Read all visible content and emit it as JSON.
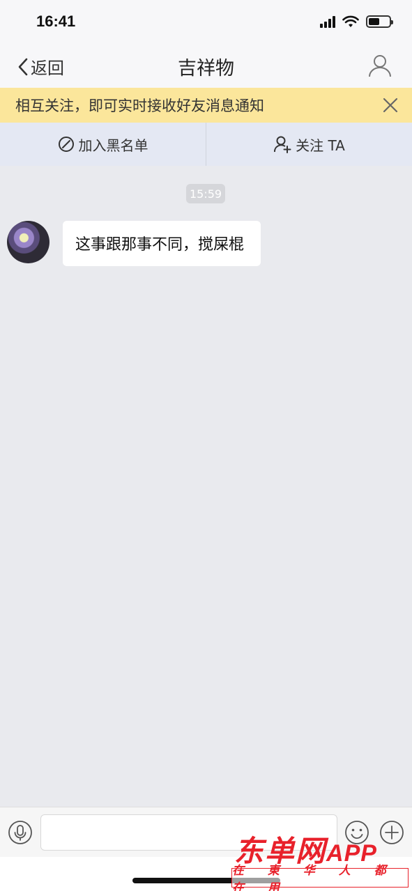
{
  "status_bar": {
    "time": "16:41",
    "battery_level": 0.55
  },
  "nav": {
    "back_label": "返回",
    "title": "吉祥物"
  },
  "notice": {
    "text": "相互关注，即可实时接收好友消息通知"
  },
  "actions": {
    "block_label": "加入黑名单",
    "follow_label": "关注 TA"
  },
  "chat": {
    "timestamp": "15:59",
    "messages": [
      {
        "text": "这事跟那事不同，搅屎棍"
      }
    ]
  },
  "input": {
    "placeholder": ""
  },
  "watermark": {
    "brand": "东单网",
    "brand_suffix": "APP",
    "slogan": "在 東 华 人 都 在 用"
  },
  "colors": {
    "notice_bg": "#fbe69b",
    "action_bg": "#e4e8f3",
    "chat_bg": "#e9eaee",
    "brand_red": "#e8212b"
  },
  "icons": [
    "chevron-left-icon",
    "user-icon",
    "close-icon",
    "block-icon",
    "follow-user-icon",
    "microphone-icon",
    "emoji-icon",
    "plus-icon"
  ]
}
